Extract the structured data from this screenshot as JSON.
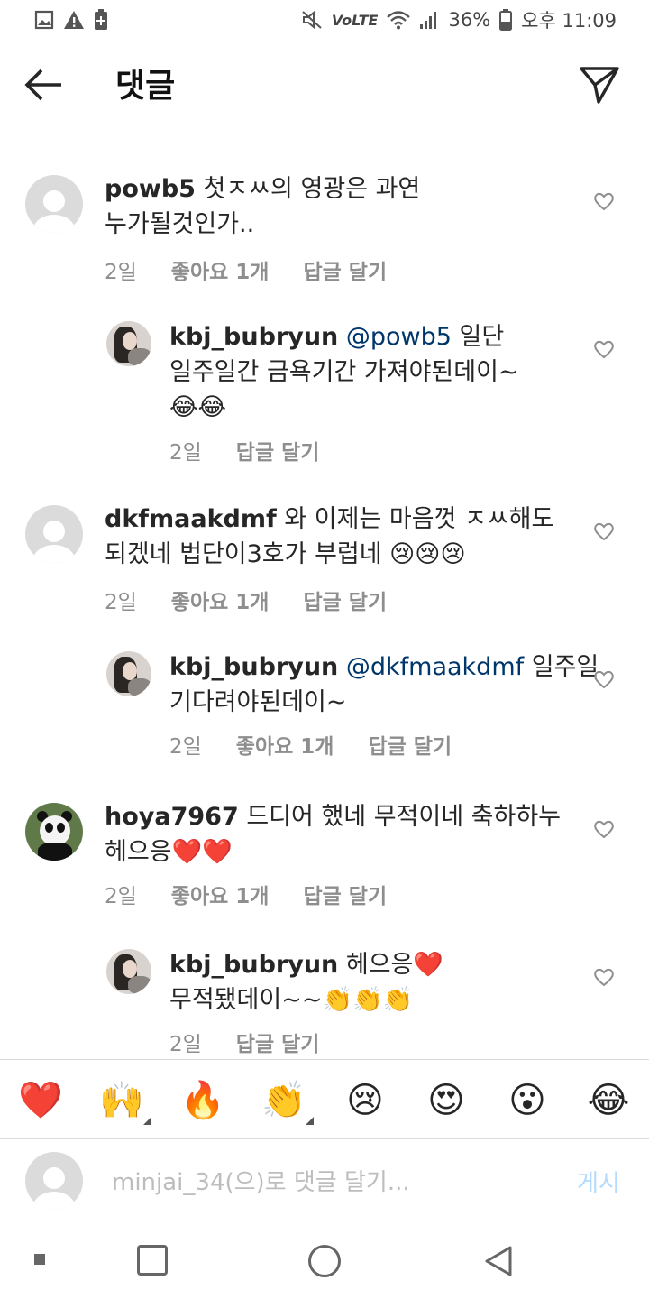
{
  "status_bar": {
    "left_icons": [
      "image-icon",
      "warning-icon",
      "battery-saver-icon"
    ],
    "network_label": "VoLTE",
    "battery": "36%",
    "time": "오후 11:09"
  },
  "header": {
    "title": "댓글"
  },
  "comments": [
    {
      "username": "powb5",
      "text": "첫ㅈㅆ의 영광은 과연",
      "text_line2": "누가될것인가..",
      "time": "2일",
      "likes": "좋아요 1개",
      "reply": "답글 달기"
    },
    {
      "username": "kbj_bubryun",
      "mention": "@powb5",
      "text": "일단",
      "text_line2": "일주일간 금욕기간 가져야된데이~",
      "text_line3": "😂😂",
      "time": "2일",
      "reply": "답글 달기"
    },
    {
      "username": "dkfmaakdmf",
      "text": "와  이제는 마음껏 ㅈㅆ해도",
      "text_line2": "되겠네  법단이3호가 부럽네 😢😢😢",
      "time": "2일",
      "likes": "좋아요 1개",
      "reply": "답글 달기"
    },
    {
      "username": "kbj_bubryun",
      "mention": "@dkfmaakdmf",
      "text": "일주일",
      "text_line2": "기다려야된데이~",
      "time": "2일",
      "likes": "좋아요 1개",
      "reply": "답글 달기"
    },
    {
      "username": "hoya7967",
      "text": "드디어 했네  무적이네 축하하누",
      "text_line2": "헤으응❤️❤️",
      "time": "2일",
      "likes": "좋아요 1개",
      "reply": "답글 달기"
    },
    {
      "username": "kbj_bubryun",
      "text": "헤으응❤️",
      "text_line2": "무적됐데이~~👏👏👏",
      "time": "2일",
      "reply": "답글 달기"
    }
  ],
  "emoji_bar": {
    "emojis": [
      "❤️",
      "🙌",
      "🔥",
      "👏",
      "😢",
      "😍",
      "😮",
      "😂"
    ]
  },
  "input": {
    "placeholder": "minjai_34(으)로 댓글 달기...",
    "post_label": "게시"
  },
  "colors": {
    "mention": "#00376b",
    "meta": "#8e8e8e",
    "post_disabled": "#b3dbff"
  }
}
